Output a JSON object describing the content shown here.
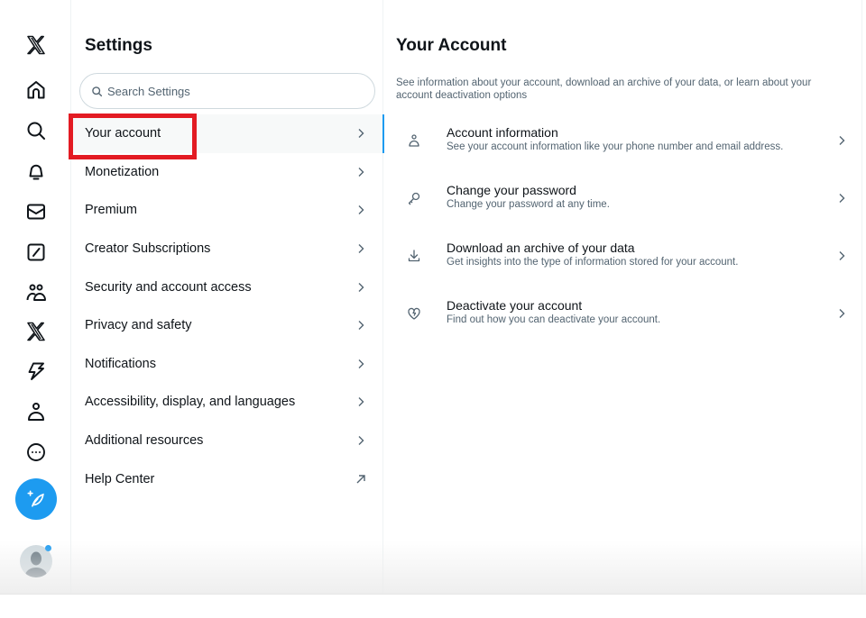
{
  "nav_rail": {
    "items": [
      {
        "name": "x-logo",
        "label": "X"
      },
      {
        "name": "home",
        "label": "Home"
      },
      {
        "name": "explore",
        "label": "Explore"
      },
      {
        "name": "notifications",
        "label": "Notifications"
      },
      {
        "name": "messages",
        "label": "Messages"
      },
      {
        "name": "grok",
        "label": "Grok"
      },
      {
        "name": "communities",
        "label": "Communities"
      },
      {
        "name": "premium",
        "label": "Premium"
      },
      {
        "name": "verified-orgs",
        "label": "Verified Orgs"
      },
      {
        "name": "profile",
        "label": "Profile"
      },
      {
        "name": "more",
        "label": "More"
      }
    ],
    "compose_label": "Post",
    "accent_color": "#1d9bf0"
  },
  "settings": {
    "title": "Settings",
    "search_placeholder": "Search Settings",
    "items": [
      {
        "label": "Your account",
        "icon": "chevron-right",
        "active": true
      },
      {
        "label": "Monetization",
        "icon": "chevron-right"
      },
      {
        "label": "Premium",
        "icon": "chevron-right"
      },
      {
        "label": "Creator Subscriptions",
        "icon": "chevron-right"
      },
      {
        "label": "Security and account access",
        "icon": "chevron-right"
      },
      {
        "label": "Privacy and safety",
        "icon": "chevron-right"
      },
      {
        "label": "Notifications",
        "icon": "chevron-right"
      },
      {
        "label": "Accessibility, display, and languages",
        "icon": "chevron-right"
      },
      {
        "label": "Additional resources",
        "icon": "chevron-right"
      },
      {
        "label": "Help Center",
        "icon": "external-link-arrow"
      }
    ],
    "highlight_color": "#e31b23"
  },
  "content": {
    "title": "Your Account",
    "description": "See information about your account, download an archive of your data, or learn about your account deactivation options",
    "options": [
      {
        "icon": "person",
        "title": "Account information",
        "subtitle": "See your account information like your phone number and email address."
      },
      {
        "icon": "key",
        "title": "Change your password",
        "subtitle": "Change your password at any time."
      },
      {
        "icon": "download",
        "title": "Download an archive of your data",
        "subtitle": "Get insights into the type of information stored for your account."
      },
      {
        "icon": "broken-heart",
        "title": "Deactivate your account",
        "subtitle": "Find out how you can deactivate your account."
      }
    ]
  }
}
